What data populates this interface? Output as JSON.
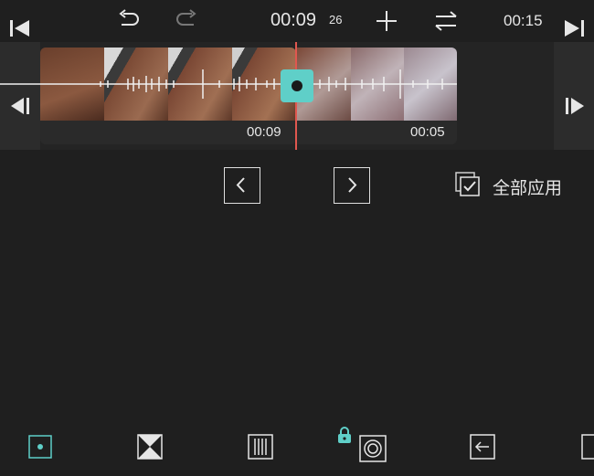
{
  "header": {
    "current_time": "00:09",
    "current_frame": "26",
    "total_time": "00:15"
  },
  "timeline": {
    "clip1_duration": "00:09",
    "clip2_duration": "00:05"
  },
  "actions": {
    "apply_all_label": "全部应用"
  },
  "colors": {
    "accent": "#5fcfc8",
    "playhead": "#e0574f",
    "background": "#1f1f1f"
  }
}
